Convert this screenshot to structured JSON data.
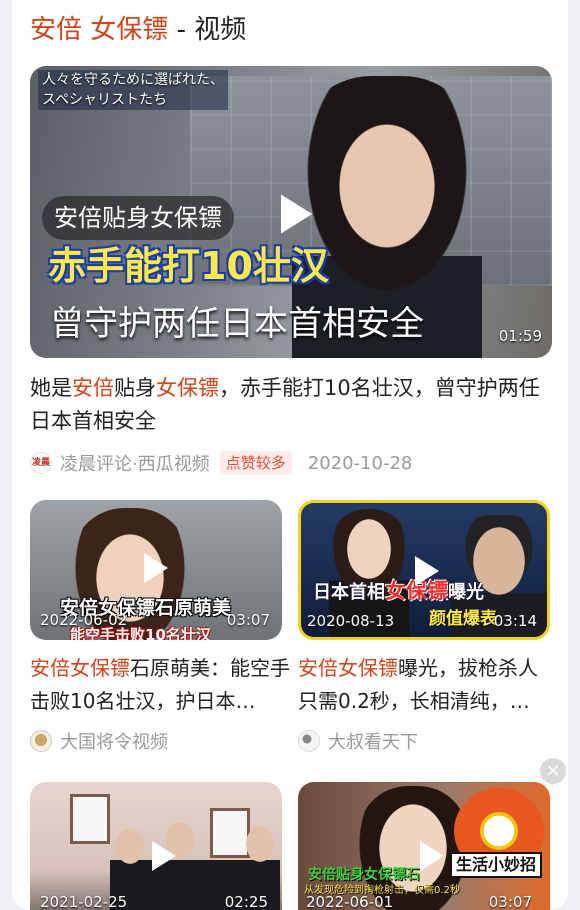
{
  "header": {
    "highlight_1": "安倍",
    "highlight_2": "女保镖",
    "suffix": " - 视频"
  },
  "featured": {
    "overlay_top_line1": "人々を守るために選ばれた、",
    "overlay_top_line2": "スペシャリストたち",
    "overlay_badge": "安倍贴身女保镖",
    "overlay_title_1": "赤手能打10壮汉",
    "overlay_title_2": "曾守护两任日本首相安全",
    "duration": "01:59",
    "title_parts": [
      "她是",
      "安倍",
      "贴身",
      "女保镖",
      "，赤手能打10名壮汉，曾守护两任日本首相安全"
    ],
    "source": "凌晨评论·西瓜视频",
    "avatar_text": "凌晨",
    "tag": "点赞较多",
    "date": "2020-10-28"
  },
  "videos": [
    {
      "overlay_text": "安倍女保镖石原萌美",
      "overlay_sub": "能空手击败10名壮汉",
      "date": "2022-06-02",
      "duration": "03:07",
      "title_hl": "安倍女保镖",
      "title_rest": "石原萌美：能空手击败10名壮汉，护日本…",
      "source": "大国将令视频"
    },
    {
      "overlay_text": "日本首相",
      "overlay_text_red": "女保镖",
      "overlay_text_end": "曝光",
      "overlay_sub": "颜值爆表",
      "date": "2020-08-13",
      "duration": "03:14",
      "title_hl": "安倍女保镖",
      "title_rest": "曝光，拔枪杀人只需0.2秒，长相清纯，…",
      "source": "大叔看天下"
    },
    {
      "date": "2021-02-25",
      "duration": "02:25"
    },
    {
      "overlay_text": "安倍贴身女保镖石",
      "overlay_sub": "从发现危险到掏枪射击，仅需0.2秒",
      "date": "2022-06-01",
      "duration": "03:07",
      "brand": "生活小妙招"
    }
  ],
  "close_glyph": "×",
  "colors": {
    "accent": "#d0451b",
    "meta": "#9a9a9a",
    "tag_bg": "#fdecea"
  }
}
